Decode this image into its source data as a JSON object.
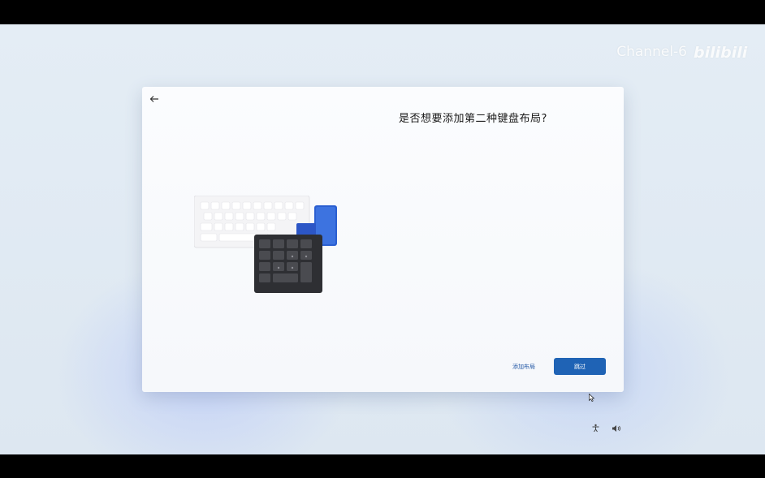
{
  "watermark": {
    "channel_text": "Channel-6",
    "logo_text": "bilibili"
  },
  "dialog": {
    "question": "是否想要添加第二种键盘布局?",
    "add_layout_label": "添加布局",
    "skip_label": "跳过"
  },
  "icons": {
    "back": "arrow-left-icon",
    "accessibility": "accessibility-icon",
    "volume": "volume-icon"
  },
  "colors": {
    "accent": "#1f63b5",
    "link": "#2358a5"
  }
}
